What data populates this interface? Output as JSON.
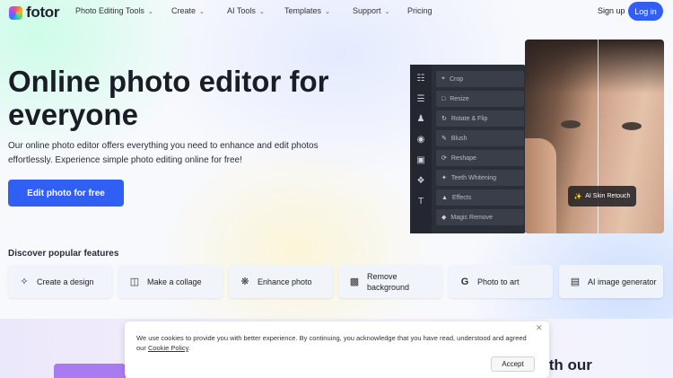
{
  "header": {
    "logo_text": "fotor",
    "nav": [
      {
        "label": "Photo Editing Tools",
        "has_menu": true
      },
      {
        "label": "Create",
        "has_menu": true
      },
      {
        "label": "AI Tools",
        "has_menu": true
      },
      {
        "label": "Templates",
        "has_menu": true
      },
      {
        "label": "Support",
        "has_menu": true
      },
      {
        "label": "Pricing",
        "has_menu": false
      }
    ],
    "signup_label": "Sign up",
    "login_label": "Log in"
  },
  "hero": {
    "title": "Online photo editor for everyone",
    "description": "Our online photo editor offers everything you need to enhance and edit photos effortlessly. Experience simple photo editing online for free!",
    "cta_label": "Edit photo for free"
  },
  "editor": {
    "menu": [
      "Crop",
      "Resize",
      "Rotate & Flip",
      "Blush",
      "Reshape",
      "Teeth Whitening",
      "Effects",
      "Magic Remove"
    ],
    "badge": "AI Skin Retouch"
  },
  "features": {
    "title": "Discover popular features",
    "items": [
      {
        "label": "Create a design",
        "icon": "magic-wand-icon"
      },
      {
        "label": "Make a collage",
        "icon": "collage-icon"
      },
      {
        "label": "Enhance photo",
        "icon": "enhance-icon"
      },
      {
        "label": "Remove background",
        "icon": "remove-bg-icon"
      },
      {
        "label": "Photo to art",
        "icon": "art-icon"
      },
      {
        "label": "AI image generator",
        "icon": "ai-image-icon"
      }
    ]
  },
  "section2": {
    "title_visible_part": "ith our"
  },
  "cookie": {
    "text": "We use cookies to provide you with better experience. By continuing, you acknowledge that you have read, understood and agreed our",
    "link": "Cookie Policy",
    "period": ".",
    "accept_label": "Accept"
  },
  "colors": {
    "primary": "#2f5ff3",
    "dark_panel": "#2b2f38",
    "accent_purple": "#a97bf2"
  }
}
